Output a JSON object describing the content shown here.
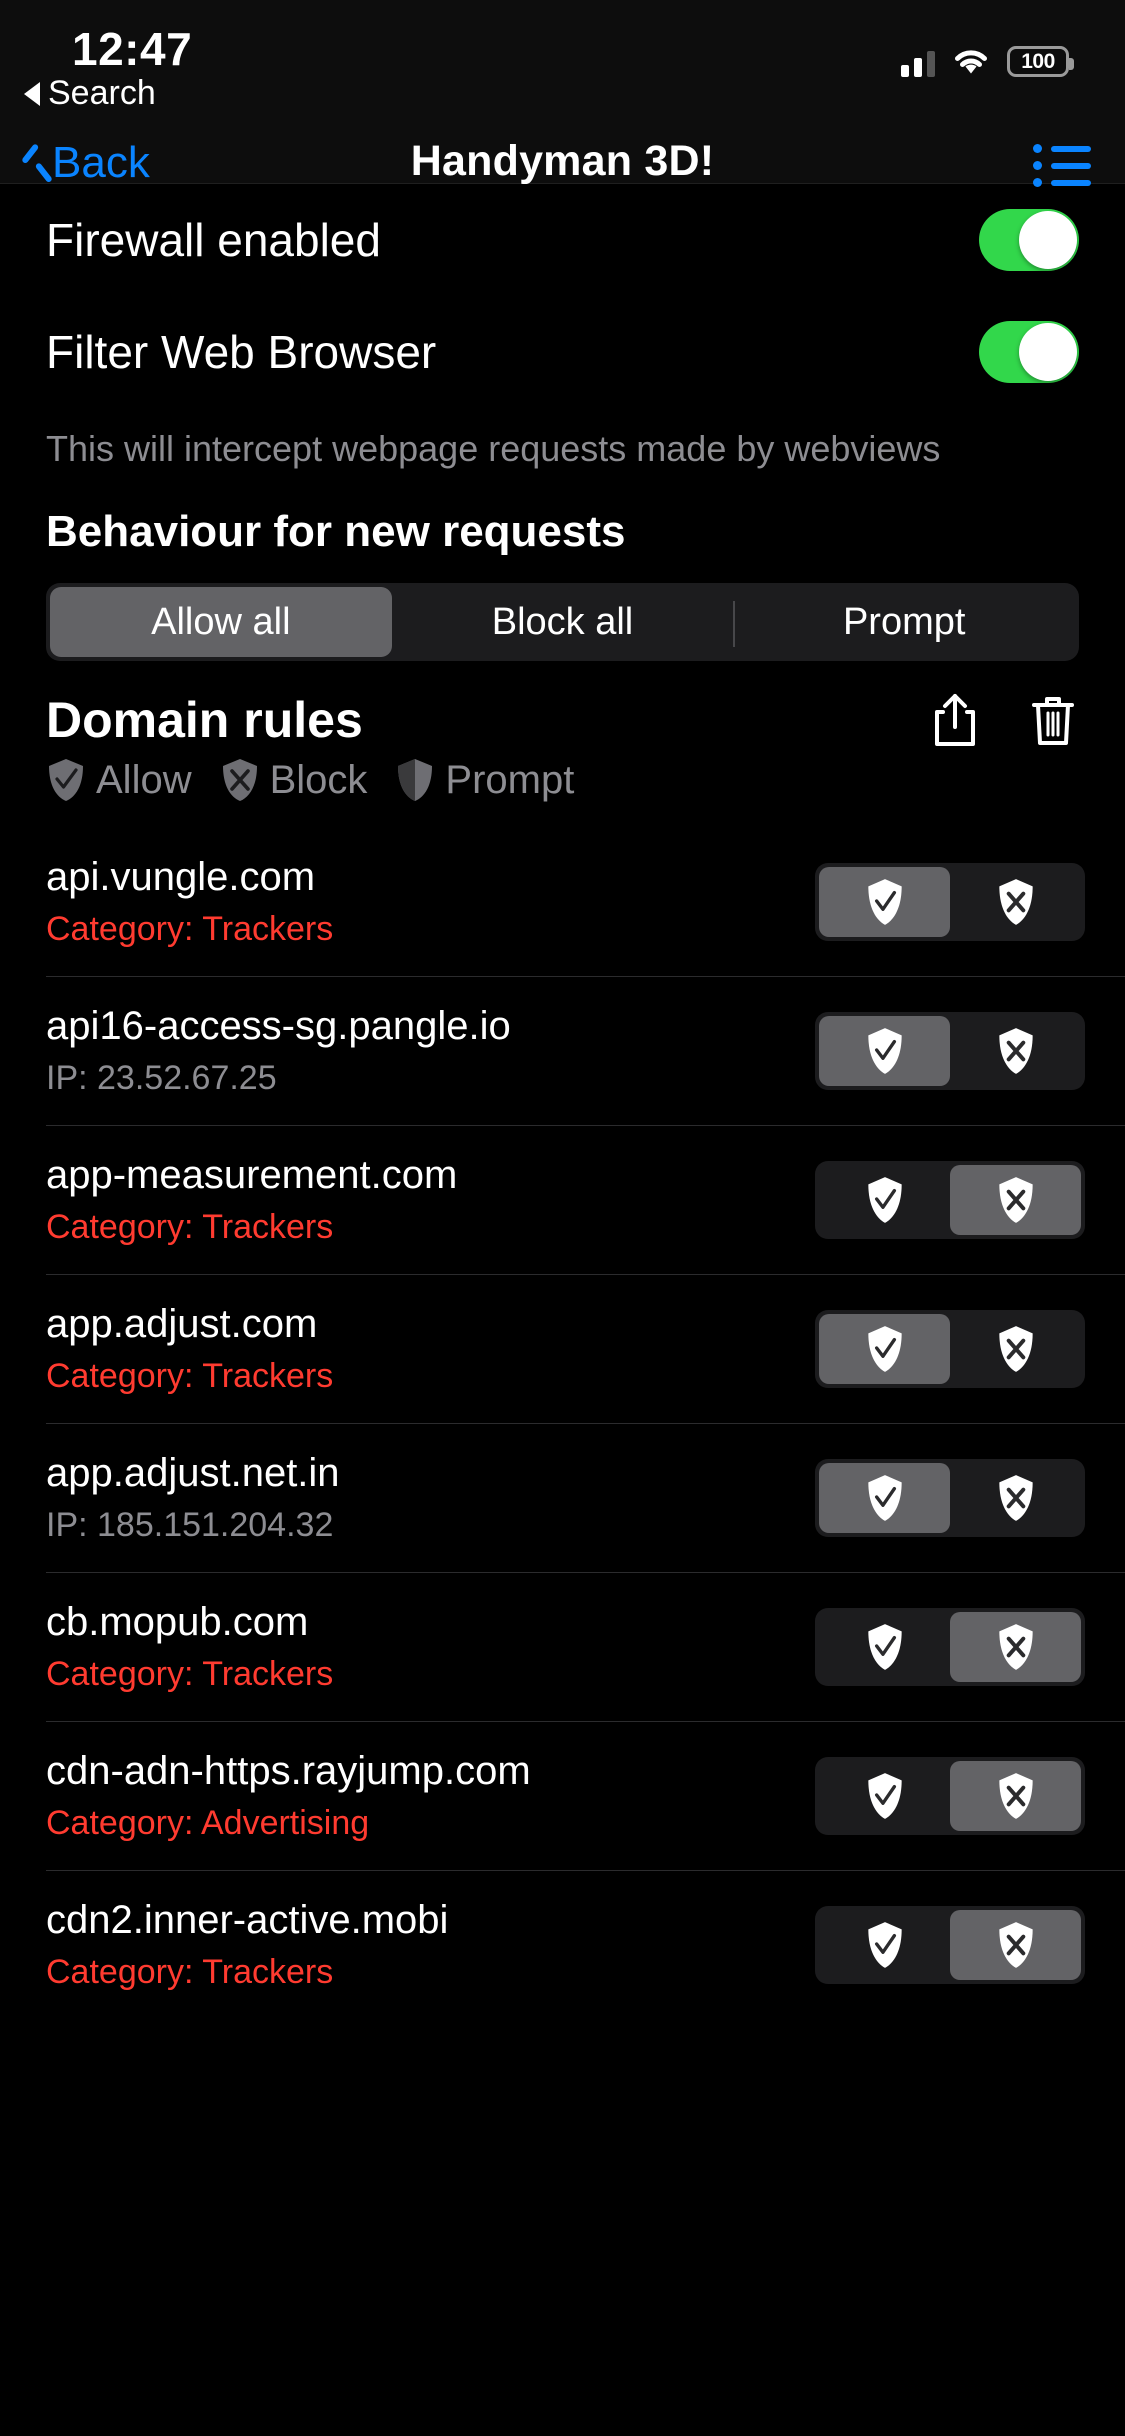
{
  "status_bar": {
    "time": "12:47",
    "return_label": "Search",
    "battery_level": "100",
    "signal_icon": "cellular-bars-icon",
    "wifi_icon": "wifi-icon",
    "battery_icon": "battery-icon"
  },
  "nav": {
    "back_label": "Back",
    "title": "Handyman 3D!",
    "list_icon": "list-bullet-icon"
  },
  "settings": {
    "firewall": {
      "label": "Firewall enabled",
      "enabled": true
    },
    "filter_web": {
      "label": "Filter Web Browser",
      "enabled": true
    },
    "helper_text": "This will intercept webpage requests made by webviews"
  },
  "behaviour": {
    "title": "Behaviour for new requests",
    "options": [
      "Allow all",
      "Block all",
      "Prompt"
    ],
    "selected_index": 0
  },
  "domain_rules": {
    "title": "Domain rules",
    "share_icon": "share-icon",
    "trash_icon": "trash-icon",
    "legend": [
      {
        "label": "Allow",
        "icon": "shield-check-icon"
      },
      {
        "label": "Block",
        "icon": "shield-x-icon"
      },
      {
        "label": "Prompt",
        "icon": "shield-half-icon"
      }
    ],
    "rows": [
      {
        "domain": "api.vungle.com",
        "sub": "Category: Trackers",
        "sub_type": "cat",
        "state": "allow"
      },
      {
        "domain": "api16-access-sg.pangle.io",
        "sub": "IP: 23.52.67.25",
        "sub_type": "ip",
        "state": "allow"
      },
      {
        "domain": "app-measurement.com",
        "sub": "Category: Trackers",
        "sub_type": "cat",
        "state": "block"
      },
      {
        "domain": "app.adjust.com",
        "sub": "Category: Trackers",
        "sub_type": "cat",
        "state": "allow"
      },
      {
        "domain": "app.adjust.net.in",
        "sub": "IP: 185.151.204.32",
        "sub_type": "ip",
        "state": "allow"
      },
      {
        "domain": "cb.mopub.com",
        "sub": "Category: Trackers",
        "sub_type": "cat",
        "state": "block"
      },
      {
        "domain": "cdn-adn-https.rayjump.com",
        "sub": "Category: Advertising",
        "sub_type": "cat",
        "state": "block"
      },
      {
        "domain": "cdn2.inner-active.mobi",
        "sub": "Category: Trackers",
        "sub_type": "cat",
        "state": "block"
      }
    ]
  },
  "colors": {
    "accent_blue": "#0a84ff",
    "toggle_green": "#32d74b",
    "category_red": "#ff3b30",
    "secondary_gray": "#8d8d92",
    "segment_selected": "#636366",
    "segment_track": "#1c1c1e"
  }
}
